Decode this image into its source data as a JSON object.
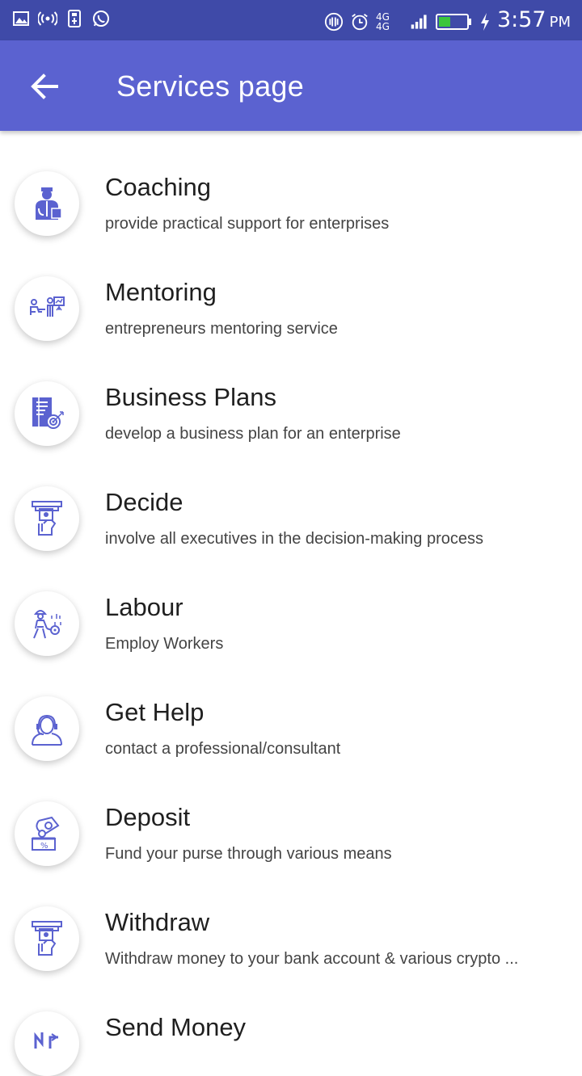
{
  "status_bar": {
    "time": "3:57",
    "ampm": "PM",
    "network": "4G 4G",
    "left_icons": [
      "image-icon",
      "broadcast-icon",
      "usb-icon",
      "whatsapp-icon"
    ],
    "right_icons": [
      "vibrate-icon",
      "alarm-icon",
      "signal-icon",
      "battery-icon",
      "charging-icon"
    ]
  },
  "app_bar": {
    "title": "Services page",
    "back_icon": "arrow-back-icon",
    "color": "#5b62d0"
  },
  "services": [
    {
      "title": "Coaching",
      "subtitle": "provide practical support for enterprises",
      "icon": "coach-icon"
    },
    {
      "title": "Mentoring",
      "subtitle": "entrepreneurs mentoring service",
      "icon": "mentoring-icon"
    },
    {
      "title": "Business Plans",
      "subtitle": "develop a business plan for an enterprise",
      "icon": "business-plan-icon"
    },
    {
      "title": "Decide",
      "subtitle": "involve all executives in the decision-making process",
      "icon": "atm-cash-icon"
    },
    {
      "title": "Labour",
      "subtitle": "Employ Workers",
      "icon": "worker-icon"
    },
    {
      "title": "Get Help",
      "subtitle": "contact a professional/consultant",
      "icon": "headset-user-icon"
    },
    {
      "title": "Deposit",
      "subtitle": "Fund your purse through various means",
      "icon": "deposit-icon"
    },
    {
      "title": "Withdraw",
      "subtitle": "Withdraw money to your bank account & various crypto ...",
      "icon": "atm-cash-icon"
    },
    {
      "title": "Send Money",
      "subtitle": "",
      "icon": "send-money-icon"
    }
  ],
  "colors": {
    "status_bar": "#3f4aa8",
    "app_bar": "#5b62d0",
    "icon": "#5b62d0"
  }
}
